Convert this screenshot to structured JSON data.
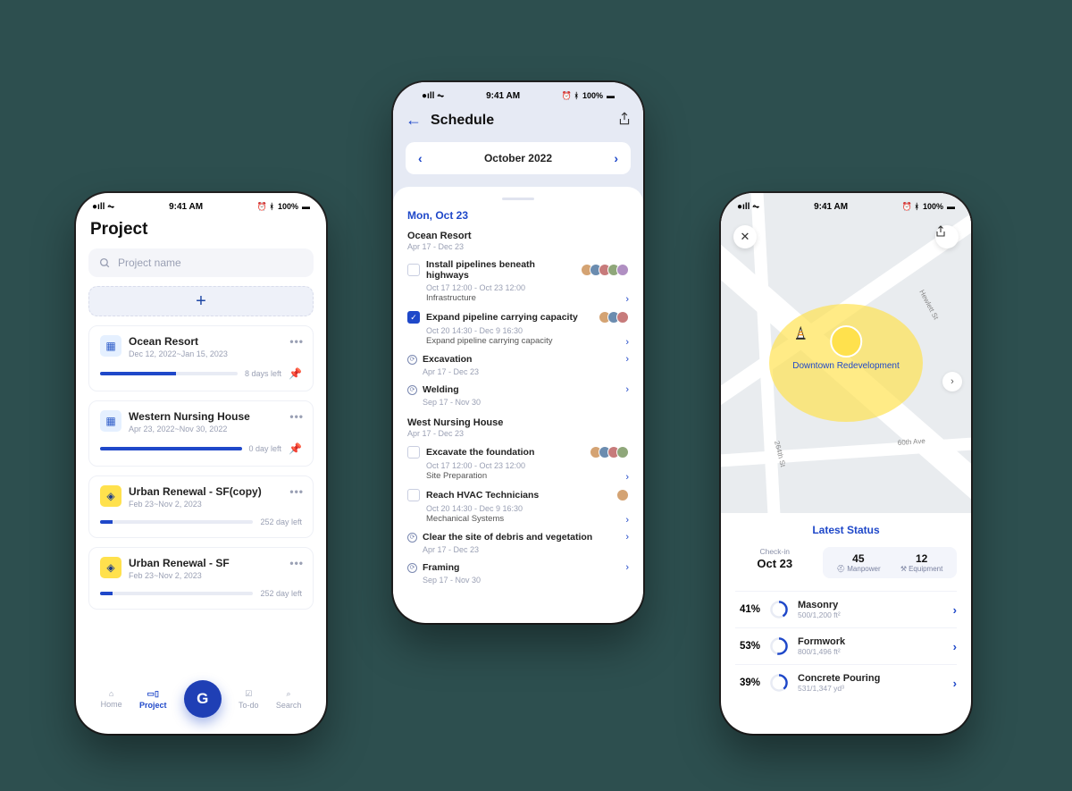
{
  "status": {
    "time": "9:41 AM",
    "battery": "100%"
  },
  "phone1": {
    "title": "Project",
    "search_placeholder": "Project name",
    "tabs": {
      "home": "Home",
      "project": "Project",
      "todo": "To-do",
      "search": "Search"
    },
    "projects": [
      {
        "name": "Ocean Resort",
        "dates": "Dec 12, 2022~Jan 15, 2023",
        "days": "8 days left",
        "progress": 55,
        "pinned": true,
        "icon": "blue"
      },
      {
        "name": "Western Nursing House",
        "dates": "Apr 23, 2022~Nov 30, 2022",
        "days": "0 day left",
        "progress": 100,
        "pinned": true,
        "icon": "blue"
      },
      {
        "name": "Urban Renewal - SF(copy)",
        "dates": "Feb 23~Nov 2, 2023",
        "days": "252 day left",
        "progress": 8,
        "pinned": false,
        "icon": "yellow"
      },
      {
        "name": "Urban Renewal - SF",
        "dates": "Feb 23~Nov 2, 2023",
        "days": "252 day left",
        "progress": 8,
        "pinned": false,
        "icon": "yellow"
      }
    ]
  },
  "phone2": {
    "title": "Schedule",
    "month": "October 2022",
    "day": "Mon, Oct 23",
    "groups": [
      {
        "name": "Ocean Resort",
        "dates": "Apr 17 - Dec 23",
        "tasks": [
          {
            "done": false,
            "name": "Install pipelines beneath highways",
            "meta": "Oct 17 12:00 - Oct 23 12:00",
            "cat": "Infrastructure",
            "avatars": 5
          },
          {
            "done": true,
            "name": "Expand pipeline carrying capacity",
            "meta": "Oct 20 14:30 - Dec 9 16:30",
            "cat": "Expand pipeline carrying capacity",
            "avatars": 3
          }
        ],
        "subs": [
          {
            "name": "Excavation",
            "dates": "Apr 17 - Dec 23"
          },
          {
            "name": "Welding",
            "dates": "Sep 17 - Nov 30"
          }
        ]
      },
      {
        "name": "West Nursing House",
        "dates": "Apr 17 - Dec 23",
        "tasks": [
          {
            "done": false,
            "name": "Excavate the foundation",
            "meta": "Oct 17 12:00 - Oct 23 12:00",
            "cat": "Site Preparation",
            "avatars": 4
          },
          {
            "done": false,
            "name": "Reach HVAC Technicians",
            "meta": "Oct 20 14:30 - Dec 9 16:30",
            "cat": "Mechanical Systems",
            "avatars": 1
          }
        ],
        "subs": [
          {
            "name": "Clear the site of debris and vegetation",
            "dates": "Apr 17 - Dec 23"
          },
          {
            "name": "Framing",
            "dates": "Sep 17 - Nov 30"
          }
        ]
      }
    ]
  },
  "phone3": {
    "map_label": "Downtown Redevelopment",
    "latest": "Latest Status",
    "checkin_label": "Check-in",
    "checkin_date": "Oct 23",
    "stats": [
      {
        "n": "45",
        "l": "Manpower"
      },
      {
        "n": "12",
        "l": "Equipment"
      }
    ],
    "progress": [
      {
        "pct": "41%",
        "p": 41,
        "name": "Masonry",
        "sub": "500/1,200 ft²"
      },
      {
        "pct": "53%",
        "p": 53,
        "name": "Formwork",
        "sub": "800/1,496 ft²"
      },
      {
        "pct": "39%",
        "p": 39,
        "name": "Concrete Pouring",
        "sub": "531/1,347 yd³"
      }
    ]
  },
  "colors": {
    "accent": "#1f48c9"
  }
}
